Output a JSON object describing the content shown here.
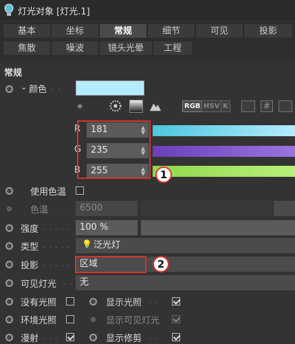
{
  "window": {
    "title": "灯光对象 [灯光.1]"
  },
  "tabs": [
    {
      "label": "基本",
      "active": false
    },
    {
      "label": "坐标",
      "active": false
    },
    {
      "label": "常规",
      "active": true
    },
    {
      "label": "细节",
      "active": false
    },
    {
      "label": "可见",
      "active": false
    },
    {
      "label": "投影",
      "active": false
    },
    {
      "label": "焦散",
      "active": false
    },
    {
      "label": "噪波",
      "active": false
    },
    {
      "label": "镜头光晕",
      "active": false
    },
    {
      "label": "工程",
      "active": false
    }
  ],
  "section_title": "常规",
  "color": {
    "label": "颜色",
    "swatch_color": "#b5ebff",
    "picker_modes": [
      "RGB",
      "HSV",
      "K"
    ],
    "r": {
      "label": "R",
      "value": "181"
    },
    "g": {
      "label": "G",
      "value": "235"
    },
    "b": {
      "label": "B",
      "value": "255"
    }
  },
  "use_temperature": {
    "label": "使用色温",
    "checked": false
  },
  "temperature": {
    "label": "色温",
    "value": "6500"
  },
  "intensity": {
    "label": "强度",
    "value": "100 %"
  },
  "type": {
    "label": "类型",
    "value": "泛光灯",
    "icon": "bulb-icon"
  },
  "shadow": {
    "label": "投影",
    "value": "区域"
  },
  "visible_light": {
    "label": "可见灯光",
    "value": "无"
  },
  "options": {
    "no_illumination": {
      "label": "没有光照",
      "checked": false
    },
    "show_illumination": {
      "label": "显示光照",
      "checked": true
    },
    "ambient": {
      "label": "环境光照",
      "checked": false
    },
    "show_visible_light": {
      "label": "显示可见灯光",
      "checked": true
    },
    "diffuse": {
      "label": "漫射",
      "checked": true
    },
    "show_clipping": {
      "label": "显示修剪",
      "checked": true
    }
  },
  "callouts": {
    "one": "1",
    "two": "2"
  },
  "colors": {
    "red_slider": "#5fd3e6",
    "green_slider": "#7a4fc4",
    "blue_slider": "#9be04a",
    "highlight": "#d8342c"
  }
}
